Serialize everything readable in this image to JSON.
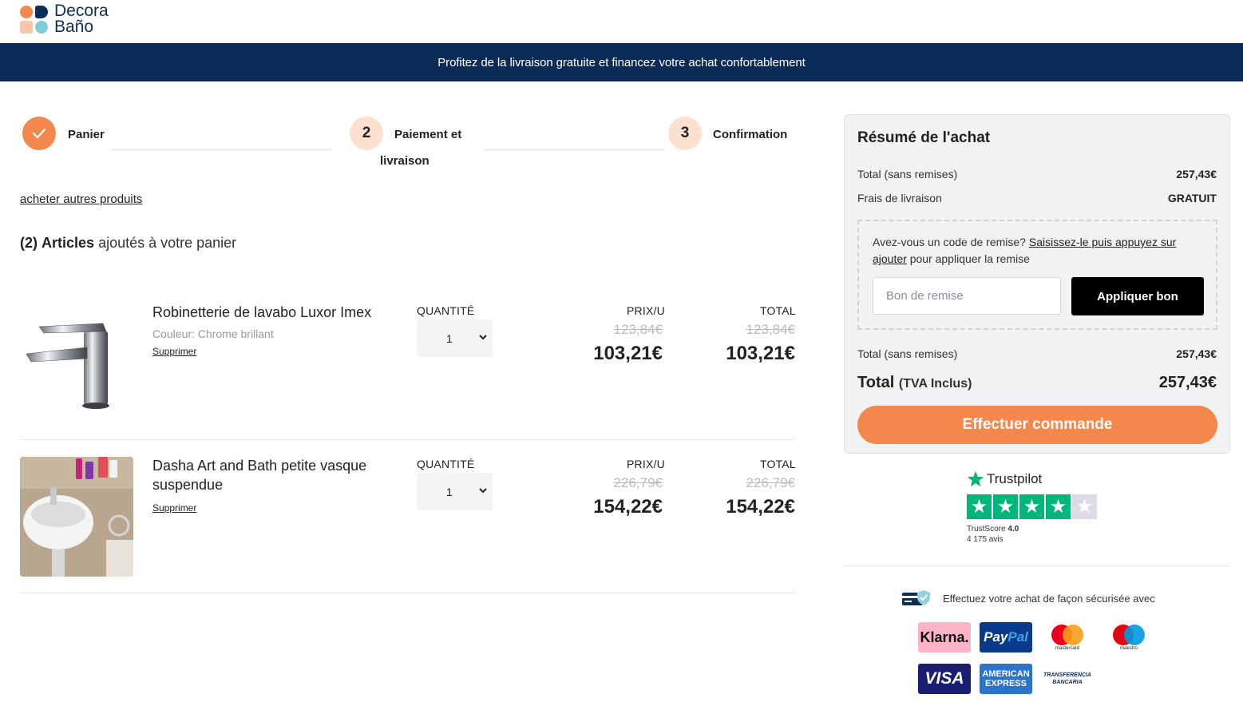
{
  "brand": {
    "line1": "Decora",
    "line2": "Baño"
  },
  "banner": "Profitez de la livraison gratuite et financez votre achat confortablement",
  "steps": [
    {
      "number": "",
      "label": "Panier",
      "state": "done"
    },
    {
      "number": "2",
      "label_line1": "Paiement et",
      "label_line2": "livraison",
      "state": "current"
    },
    {
      "number": "3",
      "label": "Confirmation",
      "state": "todo"
    }
  ],
  "shop_more": "acheter autres produits",
  "cart": {
    "count": "(2)",
    "bold": "Articles",
    "rest": " ajoutés à votre panier",
    "col_qty": "QUANTITÉ",
    "col_price": "PRIX/U",
    "col_total": "TOTAL",
    "remove": "Supprimer",
    "items": [
      {
        "name": "Robinetterie de lavabo Luxor Imex",
        "color": "Couleur: Chrome brillant",
        "qty": "1",
        "old_price": "123,84€",
        "price": "103,21€",
        "old_total": "123,84€",
        "total": "103,21€"
      },
      {
        "name": "Dasha Art and Bath petite vasque suspendue",
        "color": "",
        "qty": "1",
        "old_price": "226,79€",
        "price": "154,22€",
        "old_total": "226,79€",
        "total": "154,22€"
      }
    ]
  },
  "summary": {
    "title": "Résumé de l'achat",
    "subtotal_label": "Total (sans remises)",
    "subtotal_value": "257,43€",
    "shipping_label": "Frais de livraison",
    "shipping_value": "GRATUIT",
    "promo_q": "Avez-vous un code de remise? ",
    "promo_link": "Saisissez-le puis appuyez sur ajouter",
    "promo_rest": " pour appliquer la remise",
    "promo_placeholder": "Bon de remise",
    "promo_button": "Appliquer bon",
    "subtotal2_label": "Total (sans remises)",
    "subtotal2_value": "257,43€",
    "total_label": "Total",
    "total_suffix": "(TVA Inclus)",
    "total_value": "257,43€",
    "order_button": "Effectuer commande"
  },
  "trustpilot": {
    "name": "Trustpilot",
    "score_label": "TrustScore",
    "score": "4.0",
    "reviews": "4 175 avis",
    "rating": 4,
    "max": 5
  },
  "secure_text": "Effectuez votre achat de façon sécurisée avec",
  "payments": {
    "klarna": "Klarna.",
    "paypal_a": "Pay",
    "paypal_b": "Pal",
    "mastercard": "mastercard",
    "maestro": "maestro",
    "visa": "VISA",
    "amex_1": "AMERICAN",
    "amex_2": "EXPRESS",
    "transfer_1": "TRANSFERENCIA",
    "transfer_2": "BANCARIA"
  },
  "colors": {
    "accent": "#f4874b",
    "navy": "#0b2b57",
    "trustpilot_green": "#00b67a"
  }
}
